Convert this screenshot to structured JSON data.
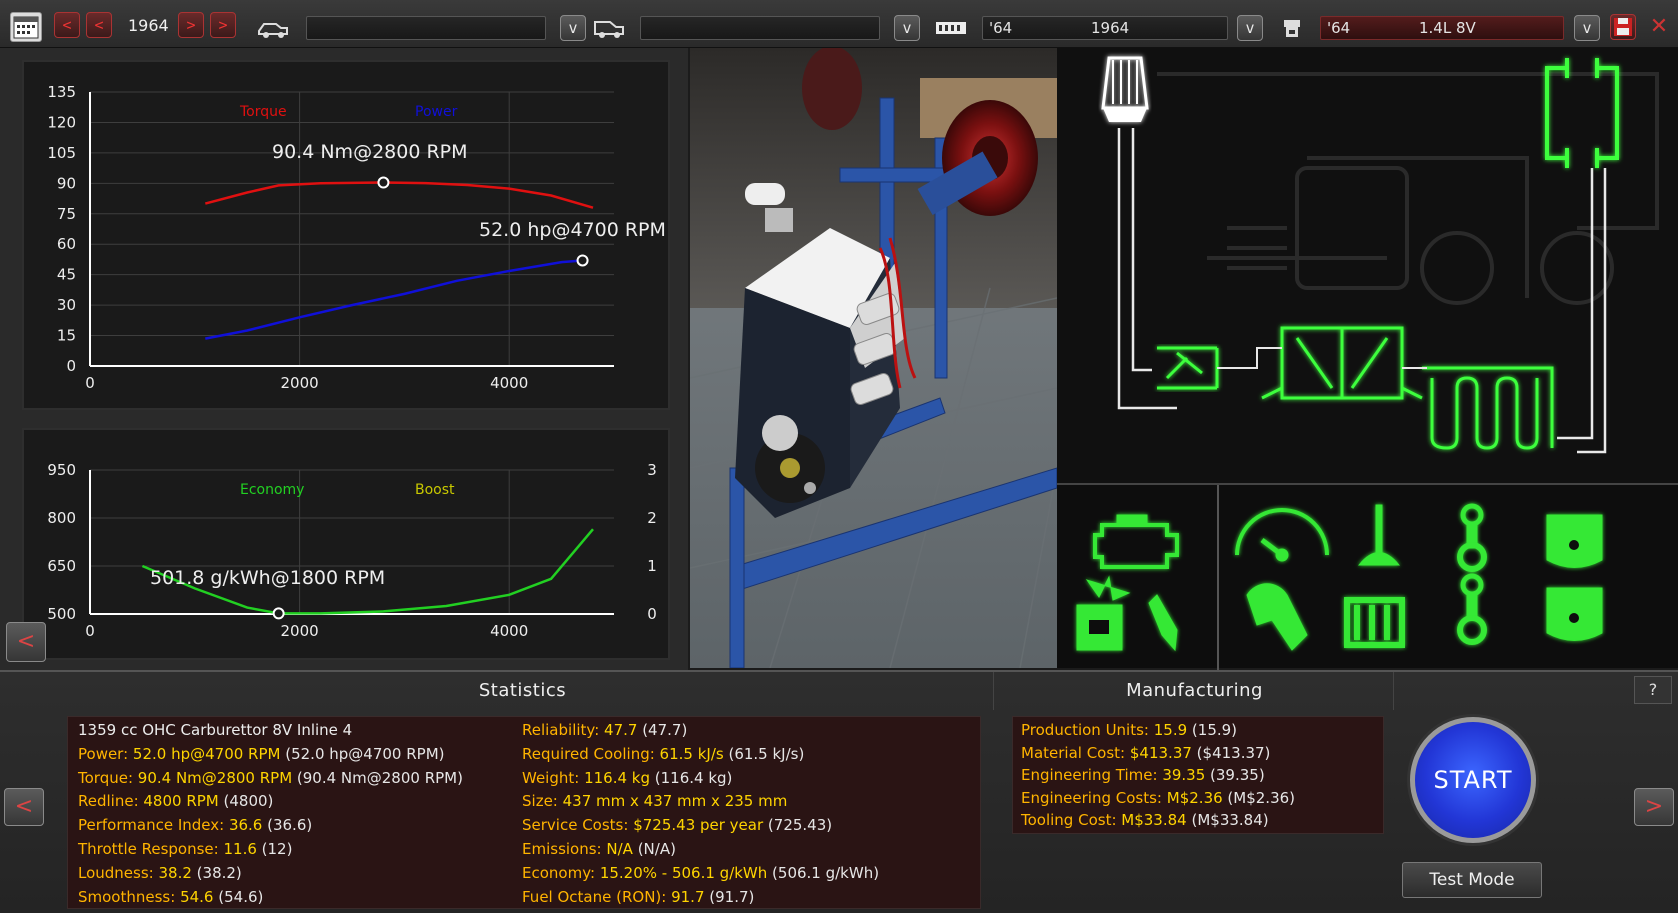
{
  "toolbar": {
    "year": "1964",
    "car_model_1": "",
    "car_model_2": "",
    "family_year": "'64",
    "family_name": "1964",
    "variant_year": "'64",
    "variant_name": "1.4L 8V",
    "icons": [
      "calendar-icon",
      "car-body-icon",
      "van-body-icon",
      "engine-family-icon",
      "engine-variant-icon",
      "save-icon",
      "close-icon"
    ]
  },
  "charts": [
    {
      "type": "line",
      "legend": [
        "Torque",
        "Power"
      ],
      "colors": {
        "Torque": "#e01010",
        "Power": "#1010d8"
      },
      "xlim": [
        0,
        5000
      ],
      "ylim": [
        0,
        135
      ],
      "x_ticks": [
        "0",
        "2000",
        "4000"
      ],
      "y_ticks": [
        "0",
        "15",
        "30",
        "45",
        "60",
        "75",
        "90",
        "105",
        "120",
        "135"
      ],
      "annotations": [
        "90.4 Nm@2800 RPM",
        "52.0 hp@4700 RPM"
      ]
    },
    {
      "type": "line",
      "legend": [
        "Economy",
        "Boost"
      ],
      "colors": {
        "Economy": "#22d022",
        "Boost": "#c8c800"
      },
      "xlim": [
        0,
        5000
      ],
      "ylim": [
        500,
        950
      ],
      "y2lim": [
        0,
        3
      ],
      "x_ticks": [
        "0",
        "2000",
        "4000"
      ],
      "y_ticks": [
        "500",
        "650",
        "800",
        "950"
      ],
      "y2_ticks": [
        "0",
        "1",
        "2",
        "3"
      ],
      "annotations": [
        "501.8 g/kWh@1800 RPM"
      ]
    }
  ],
  "chart_data": [
    {
      "type": "line",
      "title": "",
      "xlabel": "",
      "ylabel": "",
      "xlim": [
        0,
        5000
      ],
      "ylim": [
        0,
        135
      ],
      "grid": true,
      "legend": "top",
      "series": [
        {
          "name": "Torque",
          "x": [
            1100,
            1500,
            1800,
            2200,
            2800,
            3200,
            3600,
            4000,
            4400,
            4800
          ],
          "values": [
            80,
            85.5,
            89,
            90,
            90.4,
            90.1,
            89.2,
            87.4,
            84,
            78
          ]
        },
        {
          "name": "Power",
          "x": [
            1100,
            1500,
            2000,
            2500,
            3000,
            3500,
            4000,
            4500,
            4700
          ],
          "values": [
            13.5,
            17.5,
            24,
            30,
            35.5,
            42,
            46.8,
            51.2,
            52
          ]
        }
      ],
      "annotations": [
        "90.4 Nm@2800 RPM",
        "52.0 hp@4700 RPM"
      ]
    },
    {
      "type": "line",
      "title": "",
      "xlim": [
        0,
        5000
      ],
      "ylim": [
        500,
        950
      ],
      "grid": true,
      "legend": "top",
      "series": [
        {
          "name": "Economy",
          "x": [
            500,
            1000,
            1500,
            1800,
            2200,
            2800,
            3400,
            4000,
            4400,
            4800
          ],
          "values": [
            650,
            580,
            520,
            501.8,
            502,
            508,
            525,
            560,
            610,
            765
          ]
        },
        {
          "name": "Boost",
          "x": [],
          "values": []
        }
      ],
      "annotations": [
        "501.8 g/kWh@1800 RPM"
      ]
    }
  ],
  "stats": {
    "header": "Statistics",
    "left": [
      {
        "plain": "1359 cc OHC Carburettor 8V Inline 4"
      },
      {
        "k": "Power: ",
        "v": "52.0 hp@4700 RPM",
        "p": " (52.0 hp@4700 RPM)"
      },
      {
        "k": "Torque: ",
        "v": "90.4 Nm@2800 RPM",
        "p": " (90.4 Nm@2800 RPM)"
      },
      {
        "k": "Redline: ",
        "v": "4800 RPM",
        "p": " (4800)"
      },
      {
        "k": "Performance Index: ",
        "v": "36.6",
        "p": " (36.6)"
      },
      {
        "k": "Throttle Response: ",
        "v": "11.6",
        "p": " (12)"
      },
      {
        "k": "Loudness: ",
        "v": "38.2",
        "p": " (38.2)"
      },
      {
        "k": "Smoothness: ",
        "v": "54.6",
        "p": " (54.6)"
      }
    ],
    "right": [
      {
        "k": "Reliability: ",
        "v": "47.7",
        "p": " (47.7)"
      },
      {
        "k": "Required Cooling: ",
        "v": "61.5 kJ/s",
        "p": " (61.5 kJ/s)"
      },
      {
        "k": "Weight: ",
        "v": "116.4 kg",
        "p": " (116.4 kg)"
      },
      {
        "k": "Size: ",
        "v": "437 mm x 437 mm x 235 mm",
        "p": ""
      },
      {
        "k": "Service Costs: ",
        "v": "$725.43 per year",
        "p": " (725.43)"
      },
      {
        "k": "Emissions: ",
        "v": "N/A",
        "p": " (N/A)"
      },
      {
        "k": "Economy: ",
        "v": "15.20% - 506.1 g/kWh",
        "p": " (506.1 g/kWh)"
      },
      {
        "k": "Fuel Octane (RON): ",
        "v": "91.7",
        "p": " (91.7)"
      }
    ]
  },
  "manufacturing": {
    "header": "Manufacturing",
    "rows": [
      {
        "k": "Production Units: ",
        "v": "15.9",
        "p": " (15.9)"
      },
      {
        "k": "Material Cost: ",
        "v": "$413.37",
        "p": " ($413.37)"
      },
      {
        "k": "Engineering Time: ",
        "v": "39.35",
        "p": " (39.35)"
      },
      {
        "k": "Engineering Costs: ",
        "v": "M$2.36",
        "p": " (M$2.36)"
      },
      {
        "k": "Tooling Cost: ",
        "v": "M$33.84",
        "p": " (M$33.84)"
      }
    ]
  },
  "buttons": {
    "start": "START",
    "test_mode": "Test Mode",
    "help": "?",
    "prev": "<",
    "next": ">"
  },
  "parts": [
    "engine-block-icon",
    "gauge-icon",
    "valve-icon",
    "conrod-icon",
    "piston-icon",
    "ignition-icon",
    "fuel-injector-icon",
    "crankshaft-icon",
    "camshaft-icon",
    "conrod-2-icon",
    "piston-2-icon"
  ]
}
